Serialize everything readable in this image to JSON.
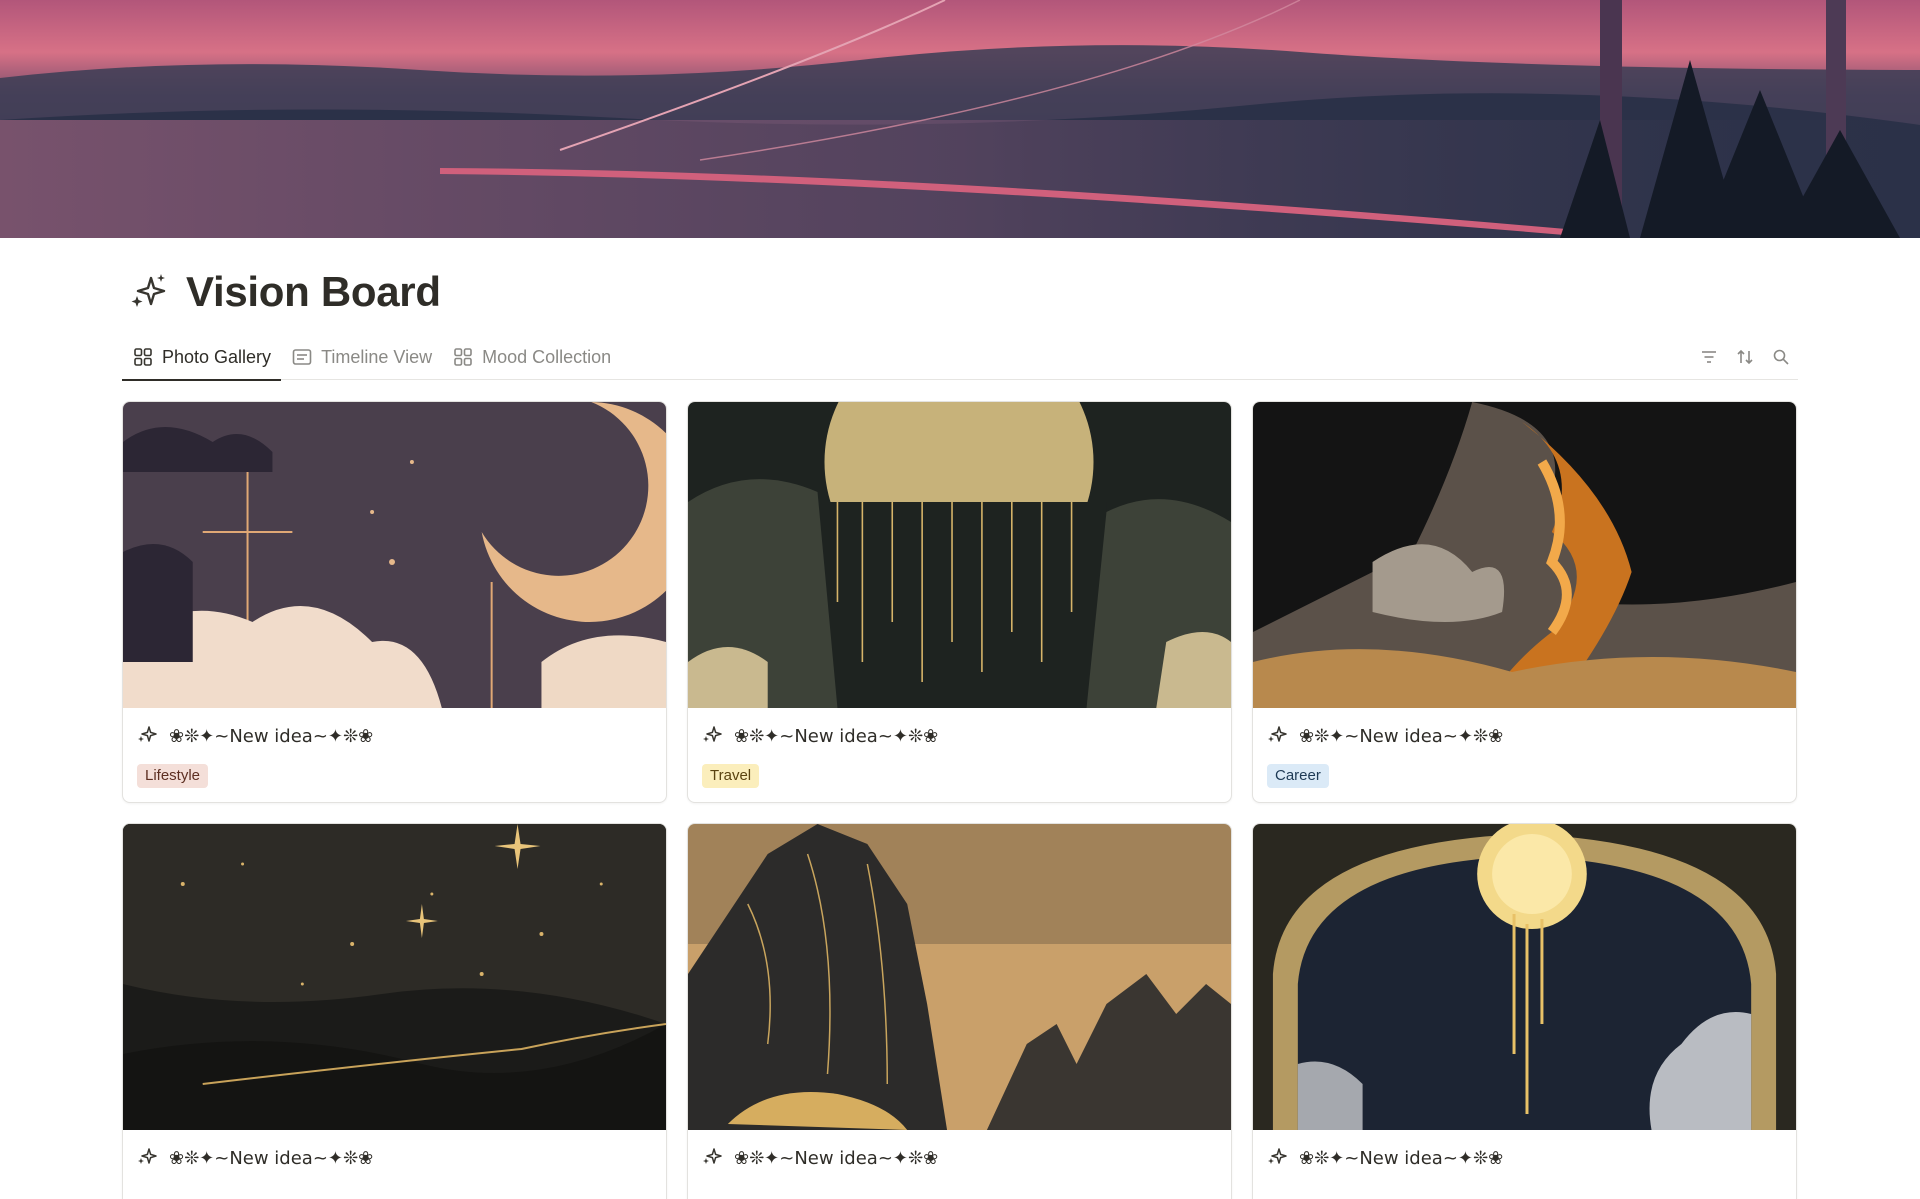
{
  "page": {
    "title": "Vision Board",
    "title_icon": "sparkles-icon"
  },
  "tabs": [
    {
      "label": "Photo Gallery",
      "icon": "gallery-grid-icon",
      "active": true
    },
    {
      "label": "Timeline View",
      "icon": "list-view-icon",
      "active": false
    },
    {
      "label": "Mood Collection",
      "icon": "gallery-grid-icon",
      "active": false
    }
  ],
  "toolbar": {
    "filter_icon": "filter-icon",
    "sort_icon": "sort-icon",
    "search_icon": "search-icon"
  },
  "cards": [
    {
      "title": "❀❊✦~New idea~✦❊❀",
      "icon": "sparkles-icon",
      "image": "crescent-moon-clouds",
      "tag": "Lifestyle",
      "tag_bg": "#f4dfd9",
      "tag_color": "#5d2f22"
    },
    {
      "title": "❀❊✦~New idea~✦❊❀",
      "icon": "sparkles-icon",
      "image": "golden-moon-dripping",
      "tag": "Travel",
      "tag_bg": "#fbeebc",
      "tag_color": "#5a4310"
    },
    {
      "title": "❀❊✦~New idea~✦❊❀",
      "icon": "sparkles-icon",
      "image": "fiery-clouds",
      "tag": "Career",
      "tag_bg": "#dbeaf7",
      "tag_color": "#1e3a55"
    },
    {
      "title": "❀❊✦~New idea~✦❊❀",
      "icon": "sparkles-icon",
      "image": "starry-night-sky",
      "tag": "",
      "tag_bg": "",
      "tag_color": ""
    },
    {
      "title": "❀❊✦~New idea~✦❊❀",
      "icon": "sparkles-icon",
      "image": "golden-mountains",
      "tag": "",
      "tag_bg": "",
      "tag_color": ""
    },
    {
      "title": "❀❊✦~New idea~✦❊❀",
      "icon": "sparkles-icon",
      "image": "moon-arch-window",
      "tag": "",
      "tag_bg": "",
      "tag_color": ""
    }
  ],
  "colors": {
    "text": "#37352f",
    "muted": "#8a8985",
    "border": "#e3e2df"
  }
}
